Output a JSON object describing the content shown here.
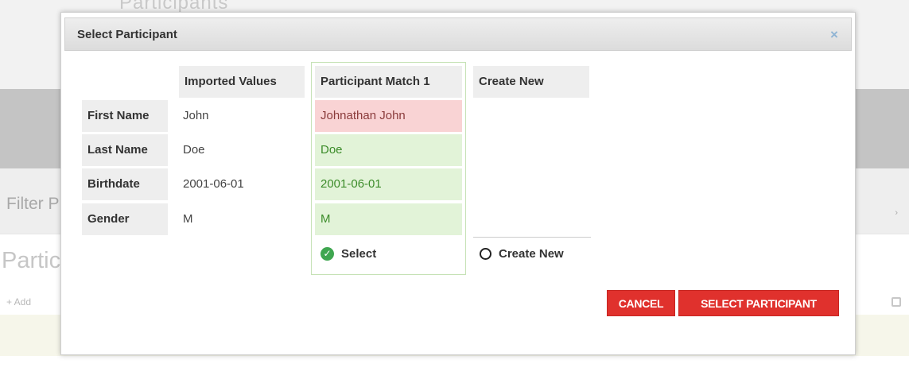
{
  "background": {
    "title_fragment": "Participants",
    "filter_label": "Filter P",
    "section_label": "Partic",
    "add_label": "+ Add",
    "chevron": "›"
  },
  "dialog": {
    "title": "Select Participant",
    "close_symbol": "×",
    "columns": {
      "imported": "Imported Values",
      "match": "Participant Match 1",
      "create": "Create New"
    },
    "rows": [
      {
        "label": "First Name",
        "imported": "John",
        "match": "Johnathan John",
        "match_status": "conflict"
      },
      {
        "label": "Last Name",
        "imported": "Doe",
        "match": "Doe",
        "match_status": "ok"
      },
      {
        "label": "Birthdate",
        "imported": "2001-06-01",
        "match": "2001-06-01",
        "match_status": "ok"
      },
      {
        "label": "Gender",
        "imported": "M",
        "match": "M",
        "match_status": "ok"
      }
    ],
    "options": {
      "select_label": "Select",
      "select_checked": true,
      "create_new_label": "Create New",
      "create_new_checked": false
    },
    "buttons": {
      "cancel": "CANCEL",
      "select_participant": "SELECT PARTICIPANT"
    }
  },
  "colors": {
    "primary_button": "#e0312d",
    "conflict_bg": "#f9d3d4",
    "match_bg": "#e2f3d8",
    "match_text": "#3c8c2a",
    "selected_icon": "#3fa650"
  }
}
